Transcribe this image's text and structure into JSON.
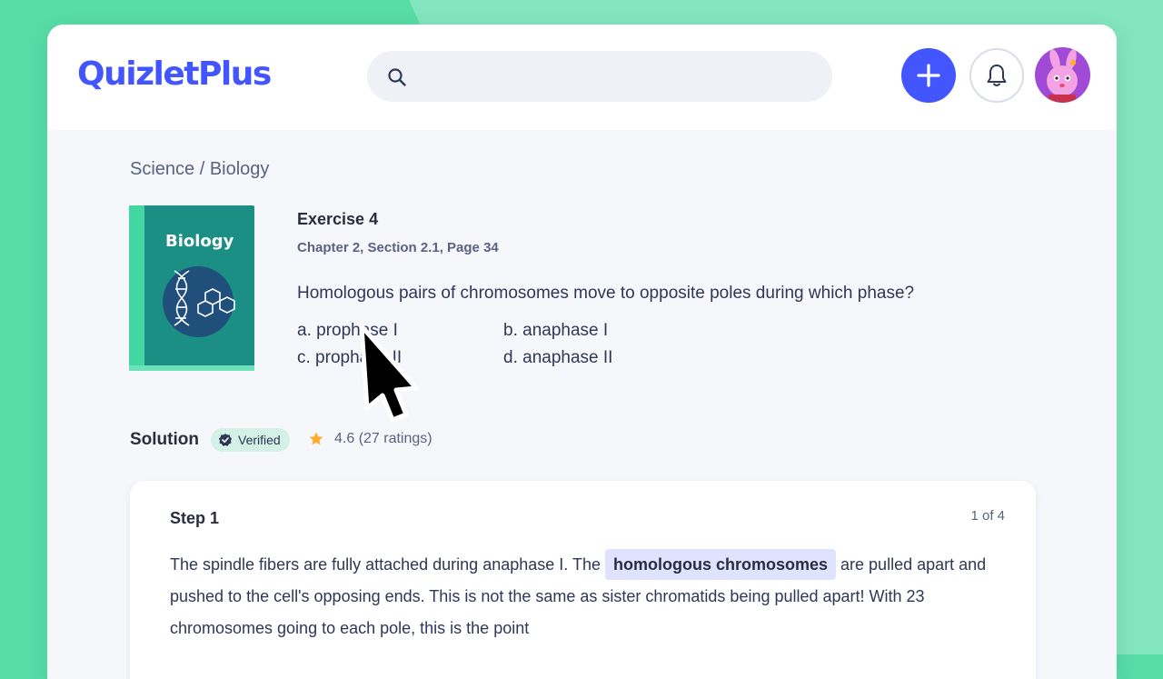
{
  "app": {
    "logo": "QuizletPlus",
    "brand_color": "#4255ff",
    "accent_color": "#57dca6"
  },
  "header": {
    "search": {
      "placeholder": "",
      "value": "",
      "icon": "search-icon"
    },
    "add_icon": "plus-icon",
    "notifications_icon": "bell-icon",
    "avatar_icon": "bunny-avatar"
  },
  "breadcrumb": "Science / Biology",
  "book": {
    "title": "Biology",
    "icon": "dna-molecule-icon"
  },
  "exercise": {
    "title": "Exercise 4",
    "subtitle": "Chapter 2, Section 2.1, Page 34",
    "question": "Homologous pairs of chromosomes move to opposite poles during which phase?",
    "options": [
      "a. prophase I",
      "b. anaphase I",
      "c. prophase II",
      "d. anaphase II"
    ]
  },
  "solution": {
    "label": "Solution",
    "badge": "Verified",
    "rating": "4.6 (27 ratings)"
  },
  "step": {
    "title": "Step 1",
    "count": "1 of 4",
    "text_before": "The spindle fibers are fully attached during anaphase I. The",
    "highlight": "homologous chromosomes",
    "text_after": "are pulled apart and pushed to the cell's opposing ends. This is not the same as sister chromatids being pulled apart! With 23 chromosomes going to each pole, this is the point"
  }
}
